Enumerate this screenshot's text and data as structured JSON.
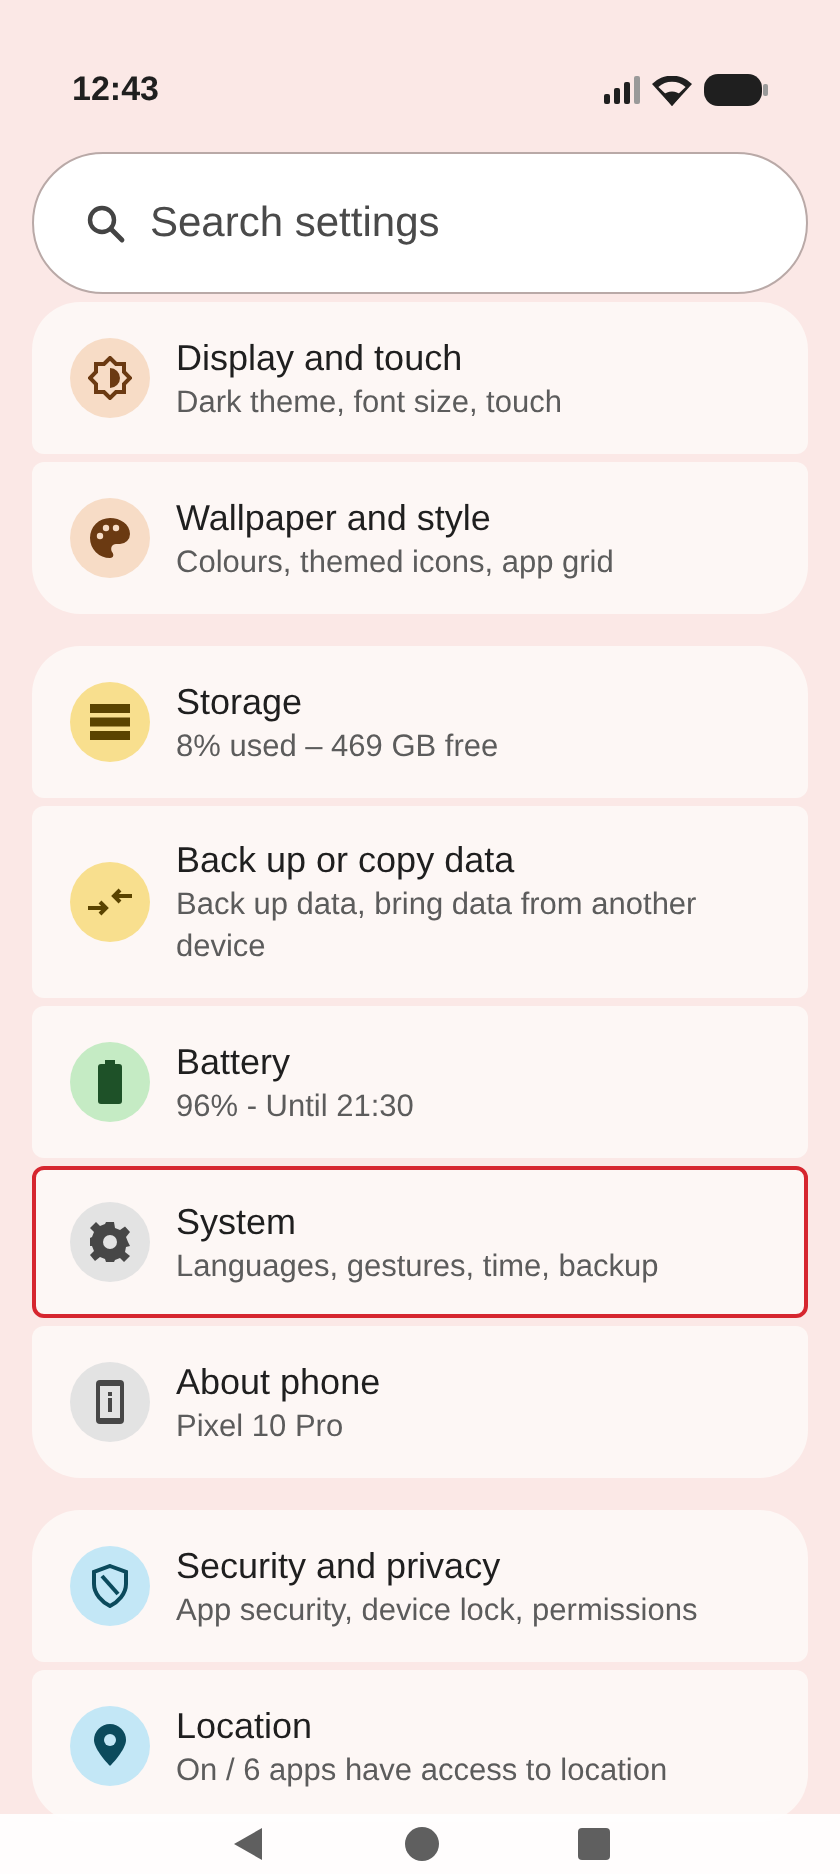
{
  "status_bar": {
    "time": "12:43"
  },
  "search": {
    "placeholder": "Search settings"
  },
  "groups": [
    {
      "items": [
        {
          "kind": "display",
          "title": "Display and touch",
          "subtitle": "Dark theme, font size, touch",
          "color": "#f7dcc6",
          "highlighted": false
        },
        {
          "kind": "palette",
          "title": "Wallpaper and style",
          "subtitle": "Colours, themed icons, app grid",
          "color": "#f7dcc6",
          "highlighted": false
        }
      ]
    },
    {
      "items": [
        {
          "kind": "storage",
          "title": "Storage",
          "subtitle": "8% used – 469 GB free",
          "color": "#f8df8e",
          "highlighted": false
        },
        {
          "kind": "backup",
          "title": "Back up or copy data",
          "subtitle": "Back up data, bring data from another device",
          "color": "#f8df8e",
          "highlighted": false
        },
        {
          "kind": "battery",
          "title": "Battery",
          "subtitle": "96% - Until 21:30",
          "color": "#c5ebc4",
          "highlighted": false
        },
        {
          "kind": "gear",
          "title": "System",
          "subtitle": "Languages, gestures, time, backup",
          "color": "#e3e3e3",
          "highlighted": true
        },
        {
          "kind": "info",
          "title": "About phone",
          "subtitle": "Pixel 10 Pro",
          "color": "#e3e3e3",
          "highlighted": false
        }
      ]
    },
    {
      "items": [
        {
          "kind": "shield",
          "title": "Security and privacy",
          "subtitle": "App security, device lock, permissions",
          "color": "#c3e7f6",
          "highlighted": false
        },
        {
          "kind": "pin",
          "title": "Location",
          "subtitle": "On / 6 apps have access to location",
          "color": "#c3e7f6",
          "highlighted": false
        }
      ]
    }
  ]
}
